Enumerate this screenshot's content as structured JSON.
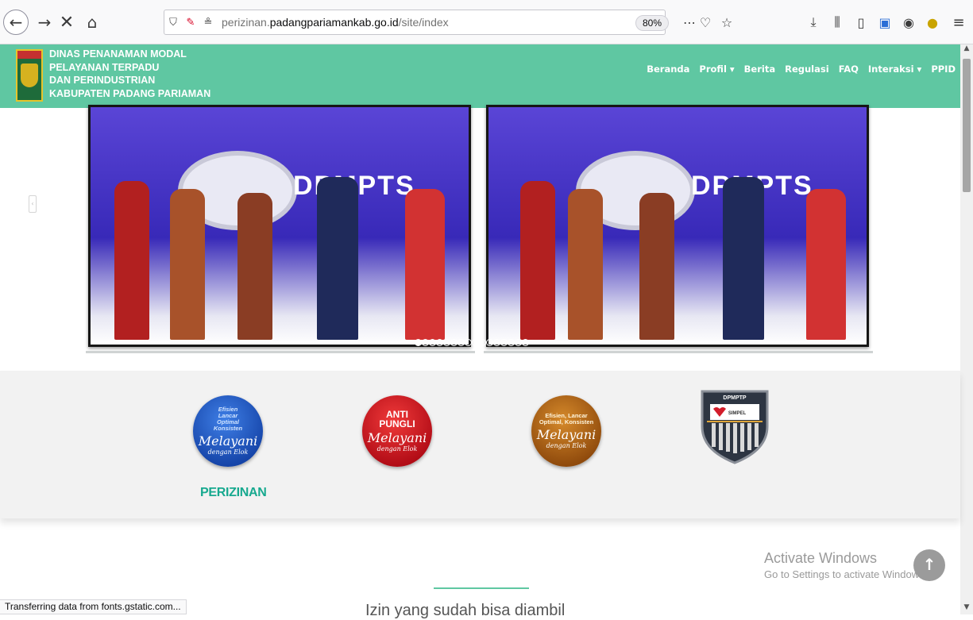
{
  "browser": {
    "url_prefix": "perizinan.",
    "url_domain": "padangpariamankab.go.id",
    "url_path": "/site/index",
    "zoom": "80%",
    "status_text": "Transferring data from fonts.gstatic.com...",
    "icons": [
      "back-icon",
      "forward-icon",
      "stop-icon",
      "home-icon",
      "shield-icon",
      "permissions-icon",
      "page-actions-icon",
      "pocket-icon",
      "bookmark-star-icon",
      "download-icon",
      "library-icon",
      "sidebar-icon",
      "extension-icon",
      "account-icon",
      "addon-icon",
      "menu-icon"
    ]
  },
  "site": {
    "agency_line1": "DINAS PENANAMAN MODAL",
    "agency_line2": "PELAYANAN TERPADU",
    "agency_line3": "DAN PERINDUSTRIAN",
    "agency_line4": "KABUPATEN PADANG PARIAMAN",
    "nav": [
      {
        "label": "Beranda"
      },
      {
        "label": "Profil ▾"
      },
      {
        "label": "Berita"
      },
      {
        "label": "Regulasi"
      },
      {
        "label": "FAQ"
      },
      {
        "label": "Interaksi ▾"
      },
      {
        "label": "PPID"
      }
    ],
    "slide_banner_text": "DPMPTS",
    "carousel_dot_count": 16,
    "carousel_active_dot": 1
  },
  "features": {
    "badge1_small1": "Efisien",
    "badge1_small2": "Lancar",
    "badge1_small3": "Optimal",
    "badge1_small4": "Konsisten",
    "badge1_script": "Melayani",
    "badge1_script2": "dengan Elok",
    "badge2_big1": "ANTI",
    "badge2_big2": "PUNGLI",
    "badge2_script": "Melayani",
    "badge2_script2": "dengan Elok",
    "badge3_small": "Efisien, Lancar",
    "badge3_small2": "Optimal, Konsisten",
    "badge3_script": "Melayani",
    "badge3_script2": "dengan Elok",
    "shield_top": "DPMPTP",
    "shield_name": "SIMPEL",
    "perizinan_label": "PERIZINAN"
  },
  "lower": {
    "section_heading": "Izin yang sudah bisa diambil",
    "activate_title": "Activate Windows",
    "activate_sub": "Go to Settings to activate Windows."
  },
  "colors": {
    "header_bg": "#5fc7a2",
    "accent_text": "#17a98f"
  }
}
